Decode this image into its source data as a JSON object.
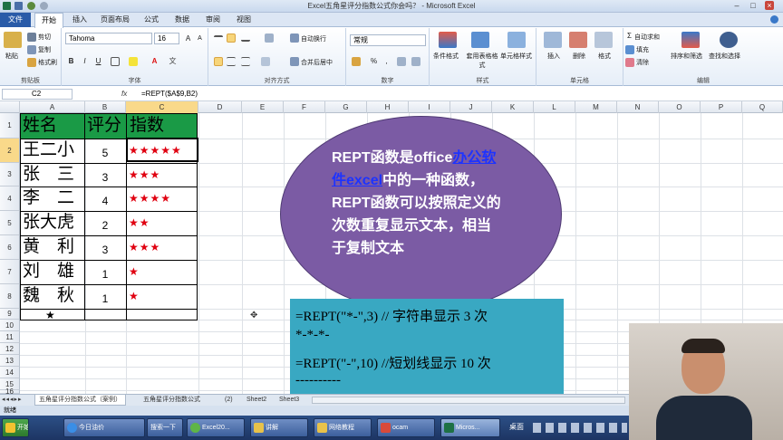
{
  "window": {
    "title": "Excel五角星评分指数公式你会吗？ - Microsoft Excel"
  },
  "tabs": [
    {
      "label": "文件"
    },
    {
      "label": "开始"
    },
    {
      "label": "插入"
    },
    {
      "label": "页面布局"
    },
    {
      "label": "公式"
    },
    {
      "label": "数据"
    },
    {
      "label": "审阅"
    },
    {
      "label": "视图"
    }
  ],
  "ribbon": {
    "clipboard": {
      "cut": "剪切",
      "copy": "复制",
      "paste": "粘贴",
      "format_painter": "格式刷",
      "label": "剪贴板"
    },
    "font": {
      "name": "Tahoma",
      "size": "16",
      "bold": "B",
      "italic": "I",
      "underline": "U",
      "label": "字体"
    },
    "alignment": {
      "wrap": "自动换行",
      "merge": "合并后居中",
      "label": "对齐方式"
    },
    "number": {
      "format": "常规",
      "percent": "%",
      "comma": ",",
      "label": "数字"
    },
    "styles": {
      "conditional": "条件格式",
      "table": "套用表格格式",
      "cell": "单元格样式",
      "label": "样式"
    },
    "cells": {
      "insert": "插入",
      "delete": "删除",
      "format": "格式",
      "label": "单元格"
    },
    "editing": {
      "autosum": "自动求和",
      "fill": "填充",
      "clear": "清除",
      "sort": "排序和筛选",
      "find": "查找和选择",
      "label": "编辑"
    }
  },
  "formula_bar": {
    "name_box": "C2",
    "fx": "fx",
    "formula": "=REPT($A$9,B2)"
  },
  "columns": [
    "A",
    "B",
    "C",
    "D",
    "E",
    "F",
    "G",
    "H",
    "I",
    "J",
    "K",
    "L",
    "M",
    "N",
    "O",
    "P",
    "Q"
  ],
  "rows": [
    "1",
    "2",
    "3",
    "4",
    "5",
    "6",
    "7",
    "8",
    "9",
    "10",
    "11",
    "12",
    "13",
    "14",
    "15",
    "16"
  ],
  "table": {
    "header": [
      "姓名",
      "评分",
      "指数"
    ],
    "rows": [
      {
        "name": "王二小",
        "score": "5",
        "stars": "★★★★★"
      },
      {
        "name": "张　三",
        "score": "3",
        "stars": "★★★"
      },
      {
        "name": "李　二",
        "score": "4",
        "stars": "★★★★"
      },
      {
        "name": "张大虎",
        "score": "2",
        "stars": "★★"
      },
      {
        "name": "黄　利",
        "score": "3",
        "stars": "★★★"
      },
      {
        "name": "刘　雄",
        "score": "1",
        "stars": "★"
      },
      {
        "name": "魏　秋",
        "score": "1",
        "stars": "★"
      }
    ],
    "star_cell": "★"
  },
  "bubble": {
    "l1a": "REPT函数是office",
    "l1link": "办公软",
    "l2link": "件excel",
    "l2b": "中的一种函数，",
    "l3": "REPT函数可以按照定义的",
    "l4": "次数重复显示文本，相当",
    "l5": "于复制文本"
  },
  "code": {
    "line1": "=REPT(\"*-\",3) // 字符串显示 3 次",
    "line2": "*-*-*-",
    "line3": "=REPT(\"-\",10) //短划线显示 10 次",
    "line4": "----------"
  },
  "sheets": [
    "五角星评分指数公式（案例）",
    "五角星评分指数公式",
    "(2)",
    "Sheet2",
    "Sheet3"
  ],
  "status": "就绪",
  "taskbar": {
    "start": "开始",
    "items": [
      "今日油价",
      "搜索一下",
      "Excel20...",
      "讲解",
      "网络教程",
      "ocam",
      "Micros...",
      "桌面"
    ]
  }
}
